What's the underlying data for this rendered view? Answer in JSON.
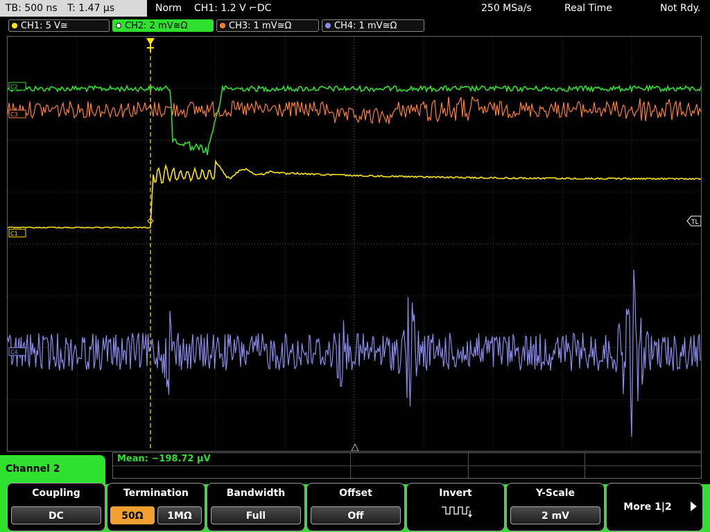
{
  "topbar": {
    "timebase": "TB: 500 ns",
    "trigger_time": "T: 1.47 µs",
    "mode": "Norm",
    "trigger_src": "CH1: 1.2 V ⌐DC",
    "sample_rate": "250 MSa/s",
    "acq": "Real Time",
    "status": "Not Rdy."
  },
  "channels": [
    {
      "label": "CH1: 5 V≅",
      "color": "#ffe600"
    },
    {
      "label": "CH2: 2 mV≅Ω",
      "color": "#2fe02f"
    },
    {
      "label": "CH3: 1 mV≅Ω",
      "color": "#ff8030"
    },
    {
      "label": "CH4: 1 mV≅Ω",
      "color": "#8c8cf0"
    }
  ],
  "markers": {
    "c2": "C2",
    "c3": "C3",
    "c1": "C1",
    "c4": "C4",
    "tl": "TL"
  },
  "measurement": {
    "mean": "Mean: −198.72 µV"
  },
  "menu": {
    "title": "Channel 2",
    "coupling_label": "Coupling",
    "coupling_value": "DC",
    "termination_label": "Termination",
    "term_opt1": "50Ω",
    "term_opt2": "1MΩ",
    "bandwidth_label": "Bandwidth",
    "bandwidth_value": "Full",
    "offset_label": "Offset",
    "offset_value": "Off",
    "invert_label": "Invert",
    "yscale_label": "Y-Scale",
    "yscale_value": "2 mV",
    "more_label": "More 1|2"
  },
  "colors": {
    "ch1": "#ffe600",
    "ch2": "#2fe02f",
    "ch3": "#ff8030",
    "ch4": "#8c8cf0",
    "accent": "#2fe02f",
    "selected": "#f0a030"
  }
}
